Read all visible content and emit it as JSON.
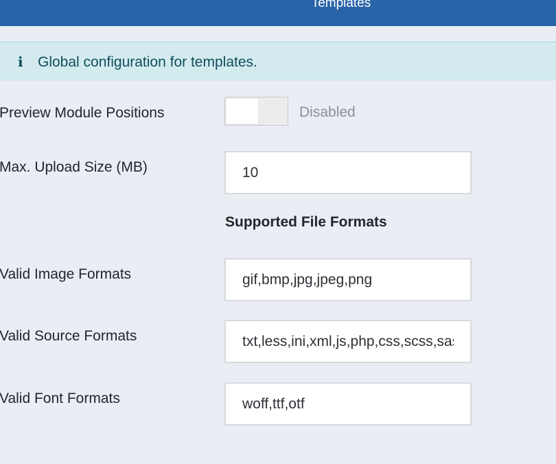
{
  "header": {
    "title": "Templates"
  },
  "alert": {
    "icon": "info-icon",
    "text": "Global configuration for templates."
  },
  "fields": {
    "preview_positions": {
      "label": "Preview Module Positions",
      "state": "Disabled",
      "enabled": false
    },
    "upload_size": {
      "label": "Max. Upload Size (MB)",
      "value": "10"
    },
    "section_heading": "Supported File Formats",
    "image_formats": {
      "label": "Valid Image Formats",
      "value": "gif,bmp,jpg,jpeg,png"
    },
    "source_formats": {
      "label": "Valid Source Formats",
      "value": "txt,less,ini,xml,js,php,css,scss,sass"
    },
    "font_formats": {
      "label": "Valid Font Formats",
      "value": "woff,ttf,otf"
    }
  },
  "colors": {
    "header_bg": "#2a64a8",
    "page_bg": "#eaeef4",
    "alert_bg": "#d3ebef",
    "alert_text": "#114d5c"
  }
}
